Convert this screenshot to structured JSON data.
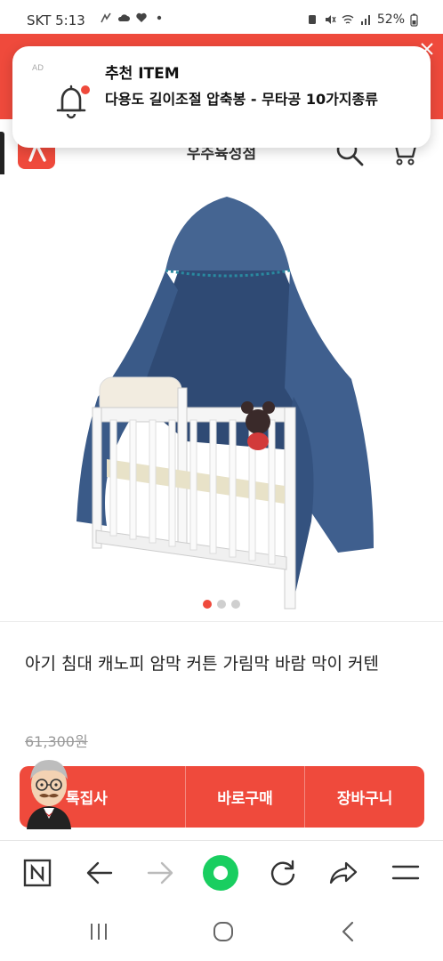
{
  "status_bar": {
    "carrier_time": "SKT 5:13",
    "battery": "52%"
  },
  "notification": {
    "ad_label": "AD",
    "title": "추천 ITEM",
    "body": "다용도 길이조절 압축봉 - 무타공 10가지종류"
  },
  "header": {
    "shop_name": "우주육성점"
  },
  "gallery": {
    "total_images": 3,
    "active_index": 0
  },
  "product": {
    "title": "아기 침대 캐노피 암막 커튼 가림막 바람 막이 커텐",
    "original_price": "61,300원"
  },
  "actions": {
    "special_offer": "톡집사",
    "buy_now": "바로구매",
    "cart": "장바구니"
  },
  "colors": {
    "accent": "#ef4a3c",
    "canopy": "#3f5f8e",
    "browser_green": "#19ce60"
  },
  "icons": [
    "bell-icon",
    "search-icon",
    "cart-icon",
    "close-icon",
    "n-home-icon",
    "back-arrow-icon",
    "forward-arrow-icon",
    "green-dot-icon",
    "refresh-icon",
    "share-icon",
    "menu-icon"
  ]
}
